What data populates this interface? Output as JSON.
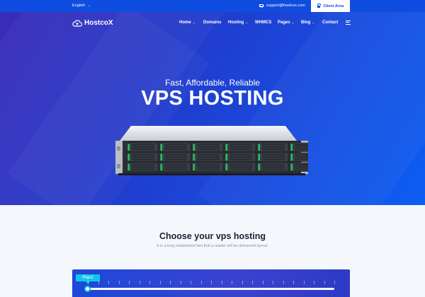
{
  "topbar": {
    "language": "English",
    "support_email": "support@hostcox.com",
    "client_area_label": "Client Area"
  },
  "header": {
    "logo_text": "HostcoX",
    "nav": [
      {
        "label": "Home",
        "dropdown": true
      },
      {
        "label": "Domains",
        "dropdown": false
      },
      {
        "label": "Hosting",
        "dropdown": true
      },
      {
        "label": "WHMCS",
        "dropdown": false
      },
      {
        "label": "Pages",
        "dropdown": true
      },
      {
        "label": "Blog",
        "dropdown": true
      },
      {
        "label": "Contact",
        "dropdown": false
      }
    ]
  },
  "hero": {
    "tagline": "Fast, Affordable, Reliable",
    "headline": "VPS HOSTING"
  },
  "section": {
    "title": "Choose your vps hosting",
    "subtitle": "It is a long established fact that a reader will be distracted layout."
  },
  "plan_slider": {
    "badge_label": "Plan1",
    "level": 0
  },
  "colors": {
    "brand_blue": "#0f4de0",
    "accent_cyan": "#12c6e8",
    "heading_dark": "#1e2233"
  }
}
